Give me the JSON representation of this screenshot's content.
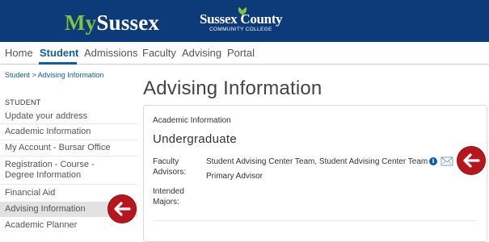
{
  "header": {
    "brand_my": "My",
    "brand_sussex": "Sussex",
    "college_name": "Sussex County",
    "college_sub": "COMMUNITY COLLEGE"
  },
  "nav": {
    "items": [
      "Home",
      "Student",
      "Admissions",
      "Faculty",
      "Advising",
      "Portal"
    ],
    "active": "Student"
  },
  "breadcrumb": "Student > Advising Information",
  "sidebar": {
    "heading": "STUDENT",
    "items": [
      "Update your address",
      "Academic Information",
      "My Account - Bursar Office",
      "Registration - Course - Degree Information",
      "Financial Aid",
      "Advising Information",
      "Academic Planner"
    ],
    "active": "Advising Information"
  },
  "main": {
    "title": "Advising Information",
    "card": {
      "heading": "Academic Information",
      "level": "Undergraduate",
      "faculty_label": "Faculty Advisors:",
      "faculty_value": "Student Advising Center Team, Student Advising Center Team",
      "faculty_role": "Primary Advisor",
      "majors_label": "Intended Majors:"
    }
  },
  "colors": {
    "header_bg": "#0d3b7a",
    "brand_green": "#7fc241",
    "link_blue": "#0d5ea8",
    "arrow_red": "#b8161d"
  }
}
